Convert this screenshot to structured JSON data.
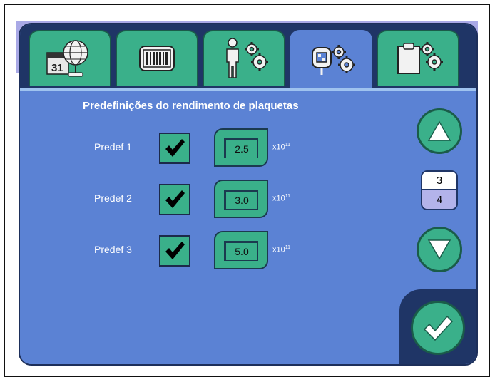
{
  "tabs": [
    {
      "icon": "calendar-globe-icon"
    },
    {
      "icon": "barcode-icon"
    },
    {
      "icon": "person-gears-icon"
    },
    {
      "icon": "device-gears-icon",
      "active": true
    },
    {
      "icon": "clipboard-gears-icon"
    }
  ],
  "page": {
    "title": "Predefinições do rendimento de plaquetas",
    "presets": [
      {
        "label": "Predef 1",
        "enabled": true,
        "value": "2.5",
        "unit": "x10",
        "exp": "11"
      },
      {
        "label": "Predef 2",
        "enabled": true,
        "value": "3.0",
        "unit": "x10",
        "exp": "11"
      },
      {
        "label": "Predef 3",
        "enabled": true,
        "value": "5.0",
        "unit": "x10",
        "exp": "11"
      }
    ]
  },
  "pager": {
    "current": "3",
    "total": "4"
  },
  "colors": {
    "panel": "#5b82d4",
    "button": "#3ab08a",
    "dark": "#1f3566",
    "lavender": "#a9a9e6"
  }
}
